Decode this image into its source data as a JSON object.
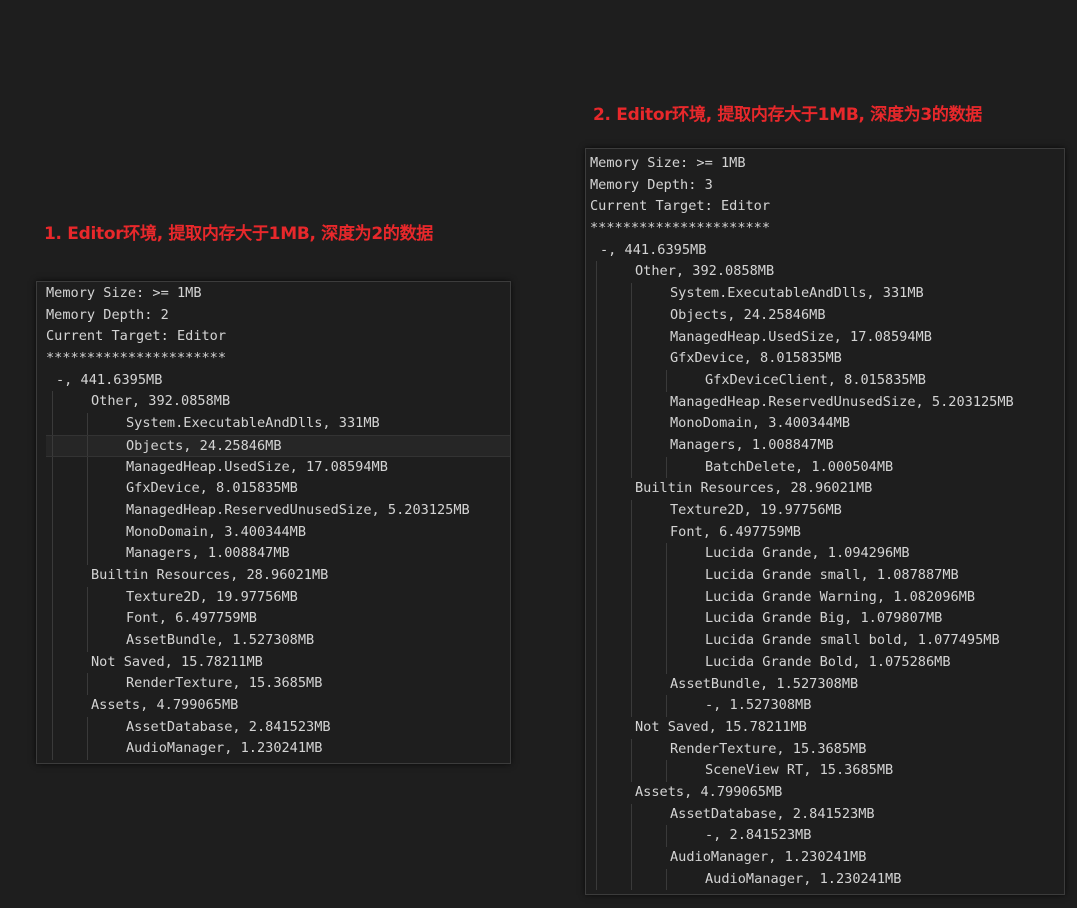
{
  "caption1": "1. Editor环境, 提取内存大于1MB, 深度为2的数据",
  "caption2": "2. Editor环境, 提取内存大于1MB, 深度为3的数据",
  "panel1": {
    "header": [
      "Memory Size: >= 1MB",
      "Memory Depth: 2",
      "Current Target: Editor",
      "**********************"
    ],
    "tree": [
      {
        "d": 0,
        "t": "-, 441.6395MB"
      },
      {
        "d": 1,
        "t": "Other, 392.0858MB"
      },
      {
        "d": 2,
        "t": "System.ExecutableAndDlls, 331MB"
      },
      {
        "d": 2,
        "t": "Objects, 24.25846MB",
        "hl": true
      },
      {
        "d": 2,
        "t": "ManagedHeap.UsedSize, 17.08594MB"
      },
      {
        "d": 2,
        "t": "GfxDevice, 8.015835MB"
      },
      {
        "d": 2,
        "t": "ManagedHeap.ReservedUnusedSize, 5.203125MB"
      },
      {
        "d": 2,
        "t": "MonoDomain, 3.400344MB"
      },
      {
        "d": 2,
        "t": "Managers, 1.008847MB"
      },
      {
        "d": 1,
        "t": "Builtin Resources, 28.96021MB"
      },
      {
        "d": 2,
        "t": "Texture2D, 19.97756MB"
      },
      {
        "d": 2,
        "t": "Font, 6.497759MB"
      },
      {
        "d": 2,
        "t": "AssetBundle, 1.527308MB"
      },
      {
        "d": 1,
        "t": "Not Saved, 15.78211MB"
      },
      {
        "d": 2,
        "t": "RenderTexture, 15.3685MB"
      },
      {
        "d": 1,
        "t": "Assets, 4.799065MB"
      },
      {
        "d": 2,
        "t": "AssetDatabase, 2.841523MB"
      },
      {
        "d": 2,
        "t": "AudioManager, 1.230241MB"
      }
    ]
  },
  "panel2": {
    "header": [
      "Memory Size: >= 1MB",
      "Memory Depth: 3",
      "Current Target: Editor",
      "**********************"
    ],
    "tree": [
      {
        "d": 0,
        "t": "-, 441.6395MB"
      },
      {
        "d": 1,
        "t": "Other, 392.0858MB"
      },
      {
        "d": 2,
        "t": "System.ExecutableAndDlls, 331MB"
      },
      {
        "d": 2,
        "t": "Objects, 24.25846MB"
      },
      {
        "d": 2,
        "t": "ManagedHeap.UsedSize, 17.08594MB"
      },
      {
        "d": 2,
        "t": "GfxDevice, 8.015835MB"
      },
      {
        "d": 3,
        "t": "GfxDeviceClient, 8.015835MB"
      },
      {
        "d": 2,
        "t": "ManagedHeap.ReservedUnusedSize, 5.203125MB"
      },
      {
        "d": 2,
        "t": "MonoDomain, 3.400344MB"
      },
      {
        "d": 2,
        "t": "Managers, 1.008847MB"
      },
      {
        "d": 3,
        "t": "BatchDelete, 1.000504MB"
      },
      {
        "d": 1,
        "t": "Builtin Resources, 28.96021MB"
      },
      {
        "d": 2,
        "t": "Texture2D, 19.97756MB"
      },
      {
        "d": 2,
        "t": "Font, 6.497759MB"
      },
      {
        "d": 3,
        "t": "Lucida Grande, 1.094296MB"
      },
      {
        "d": 3,
        "t": "Lucida Grande small, 1.087887MB"
      },
      {
        "d": 3,
        "t": "Lucida Grande Warning, 1.082096MB"
      },
      {
        "d": 3,
        "t": "Lucida Grande Big, 1.079807MB"
      },
      {
        "d": 3,
        "t": "Lucida Grande small bold, 1.077495MB"
      },
      {
        "d": 3,
        "t": "Lucida Grande Bold, 1.075286MB"
      },
      {
        "d": 2,
        "t": "AssetBundle, 1.527308MB"
      },
      {
        "d": 3,
        "t": "-, 1.527308MB"
      },
      {
        "d": 1,
        "t": "Not Saved, 15.78211MB"
      },
      {
        "d": 2,
        "t": "RenderTexture, 15.3685MB"
      },
      {
        "d": 3,
        "t": "SceneView RT, 15.3685MB"
      },
      {
        "d": 1,
        "t": "Assets, 4.799065MB"
      },
      {
        "d": 2,
        "t": "AssetDatabase, 2.841523MB"
      },
      {
        "d": 3,
        "t": "-, 2.841523MB"
      },
      {
        "d": 2,
        "t": "AudioManager, 1.230241MB"
      },
      {
        "d": 3,
        "t": "AudioManager, 1.230241MB"
      }
    ]
  }
}
